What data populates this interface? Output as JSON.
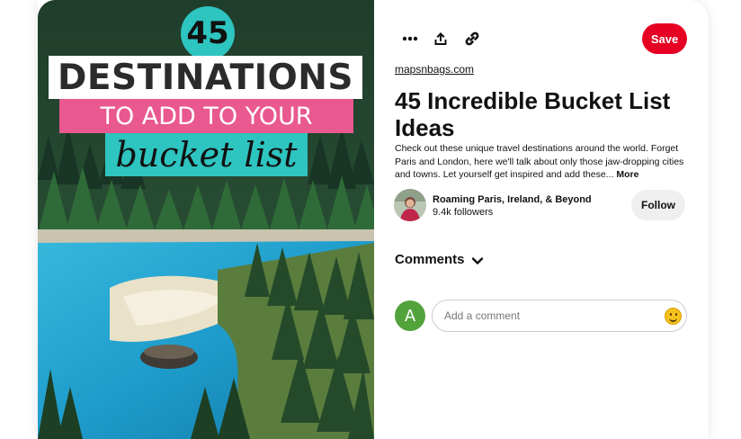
{
  "pin": {
    "image_overlay": {
      "number": "45",
      "line1": "DESTINATIONS",
      "line2": "TO ADD TO YOUR",
      "line3": "bucket list"
    },
    "source": "mapsnbags.com",
    "title": "45 Incredible Bucket List Ideas",
    "description": "Check out these unique travel destinations around the world. Forget Paris and London, here we'll talk about only those jaw-dropping cities and towns. Let yourself get inspired and add these...",
    "more_label": "More"
  },
  "toolbar": {
    "icons": [
      "more-options-icon",
      "share-icon",
      "link-icon"
    ],
    "save_label": "Save"
  },
  "creator": {
    "name": "Roaming Paris, Ireland, & Beyond",
    "followers": "9.4k followers",
    "follow_label": "Follow"
  },
  "comments": {
    "heading": "Comments",
    "user_initial": "A",
    "placeholder": "Add a comment"
  },
  "colors": {
    "save": "#e60023",
    "teal": "#2ec4c0",
    "pink": "#e9588f",
    "user_avatar": "#52a33b"
  }
}
